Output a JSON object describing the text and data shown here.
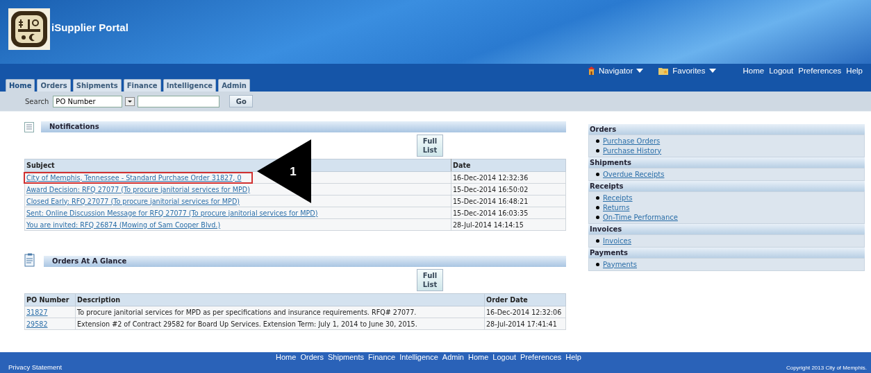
{
  "header": {
    "title": "iSupplier Portal",
    "global_menus": [
      {
        "label": "Navigator"
      },
      {
        "label": "Favorites"
      }
    ],
    "global_links": [
      "Home",
      "Logout",
      "Preferences",
      "Help"
    ]
  },
  "tabs": [
    {
      "label": "Home",
      "selected": true
    },
    {
      "label": "Orders",
      "selected": false
    },
    {
      "label": "Shipments",
      "selected": false
    },
    {
      "label": "Finance",
      "selected": false
    },
    {
      "label": "Intelligence",
      "selected": false
    },
    {
      "label": "Admin",
      "selected": false
    }
  ],
  "search": {
    "label": "Search",
    "select_value": "PO Number",
    "button": "Go"
  },
  "notifications": {
    "title": "Notifications",
    "full_list": [
      "Full",
      "List"
    ],
    "columns": [
      "Subject",
      "Date"
    ],
    "rows": [
      {
        "subject": "City of Memphis, Tennessee - Standard Purchase Order 31827, 0",
        "date": "16-Dec-2014 12:32:36",
        "highlighted": true
      },
      {
        "subject": "Award Decision: RFQ 27077 (To procure janitorial services for MPD)",
        "date": "15-Dec-2014 16:50:02",
        "highlighted": false
      },
      {
        "subject": "Closed Early: RFQ 27077 (To procure janitorial services for MPD)",
        "date": "15-Dec-2014 16:48:21",
        "highlighted": false
      },
      {
        "subject": "Sent: Online Discussion Message for RFQ 27077 (To procure janitorial services for MPD)",
        "date": "15-Dec-2014 16:03:35",
        "highlighted": false
      },
      {
        "subject": "You are invited: RFQ 26874 (Mowing of Sam Cooper Blvd.)",
        "date": "28-Jul-2014 14:14:15",
        "highlighted": false
      }
    ]
  },
  "callout": {
    "number": "1"
  },
  "orders": {
    "title": "Orders At A Glance",
    "full_list": [
      "Full",
      "List"
    ],
    "columns": [
      "PO Number",
      "Description",
      "Order Date"
    ],
    "rows": [
      {
        "po": "31827",
        "description": "To procure janitorial services for MPD as per specifications and insurance requirements. RFQ# 27077.",
        "date": "16-Dec-2014 12:32:06"
      },
      {
        "po": "29582",
        "description": "Extension #2 of Contract 29582 for Board Up Services. Extension Term: July 1, 2014 to June 30, 2015.",
        "date": "28-Jul-2014 17:41:41"
      }
    ]
  },
  "sidebar": [
    {
      "title": "Orders",
      "links": [
        "Purchase Orders",
        "Purchase History"
      ]
    },
    {
      "title": "Shipments",
      "links": [
        "Overdue Receipts"
      ]
    },
    {
      "title": "Receipts",
      "links": [
        "Receipts",
        "Returns",
        "On-Time Performance"
      ]
    },
    {
      "title": "Invoices",
      "links": [
        "Invoices"
      ]
    },
    {
      "title": "Payments",
      "links": [
        "Payments"
      ]
    }
  ],
  "footer": {
    "links": [
      "Home",
      "Orders",
      "Shipments",
      "Finance",
      "Intelligence",
      "Admin",
      "Home",
      "Logout",
      "Preferences",
      "Help"
    ],
    "privacy": "Privacy Statement",
    "copyright": "Copyright 2013 City of Memphis."
  }
}
